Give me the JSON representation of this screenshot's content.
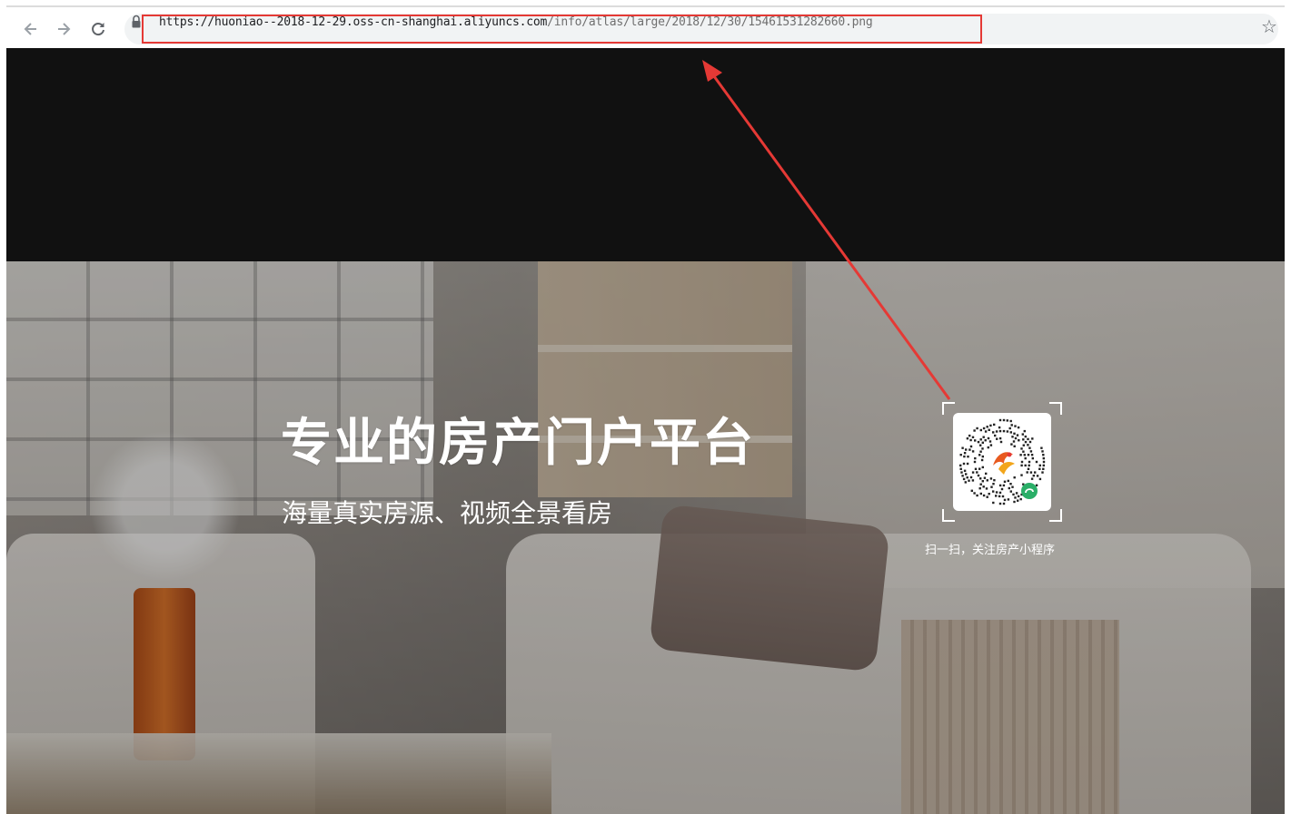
{
  "browser": {
    "url": {
      "host": "https://huoniao--2018-12-29.oss-cn-shanghai.aliyuncs.com",
      "path": "/info/atlas/large/2018/12/30/15461531282660.png"
    },
    "icons": {
      "back": "back-arrow-icon",
      "forward": "forward-arrow-icon",
      "reload": "reload-icon",
      "lock": "lock-icon",
      "bookmark": "star-icon"
    },
    "annotation_color": "#e53935"
  },
  "page": {
    "headline": "专业的房产门户平台",
    "subline": "海量真实房源、视频全景看房",
    "qr_caption": "扫一扫，关注房产小程序",
    "qr_icon": "mini-program-qr-icon",
    "background_color": "#111111"
  }
}
